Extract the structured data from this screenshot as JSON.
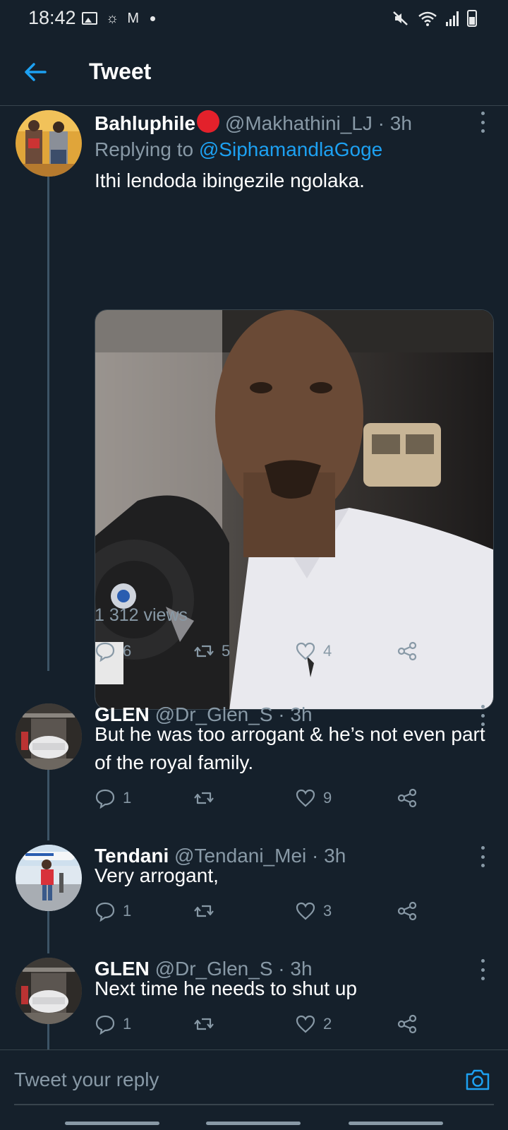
{
  "status_bar": {
    "time": "18:42",
    "mail_letter": "M"
  },
  "header": {
    "title": "Tweet"
  },
  "tweets": [
    {
      "name": "Bahluphile",
      "handle_time": "@Makhathini_LJ · 3h",
      "replying_prefix": "Replying to ",
      "replying_to": "@SiphamandlaGoge",
      "text": "Ithi lendoda ibingezile ngolaka.",
      "views": "1 312 views",
      "replies": "6",
      "retweets": "5",
      "likes": "4"
    },
    {
      "name": "GLEN",
      "handle_time": "@Dr_Glen_S · 3h",
      "text": "But he was too arrogant & he’s not even part of the royal family.",
      "replies": "1",
      "retweets": "",
      "likes": "9"
    },
    {
      "name": "Tendani",
      "handle_time": "@Tendani_Mei · 3h",
      "text": "Very arrogant,",
      "replies": "1",
      "retweets": "",
      "likes": "3"
    },
    {
      "name": "GLEN",
      "handle_time": "@Dr_Glen_S · 3h",
      "text": "Next time he needs to shut up",
      "replies": "1",
      "retweets": "",
      "likes": "2"
    }
  ],
  "reply_bar": {
    "placeholder": "Tweet your reply"
  },
  "colors": {
    "background": "#15202b",
    "accent": "#1da1f2",
    "muted": "#8899a6",
    "divider": "#38444d"
  },
  "icons": [
    "back-arrow-icon",
    "more-icon",
    "reply-icon",
    "retweet-icon",
    "like-icon",
    "share-icon",
    "camera-icon"
  ]
}
